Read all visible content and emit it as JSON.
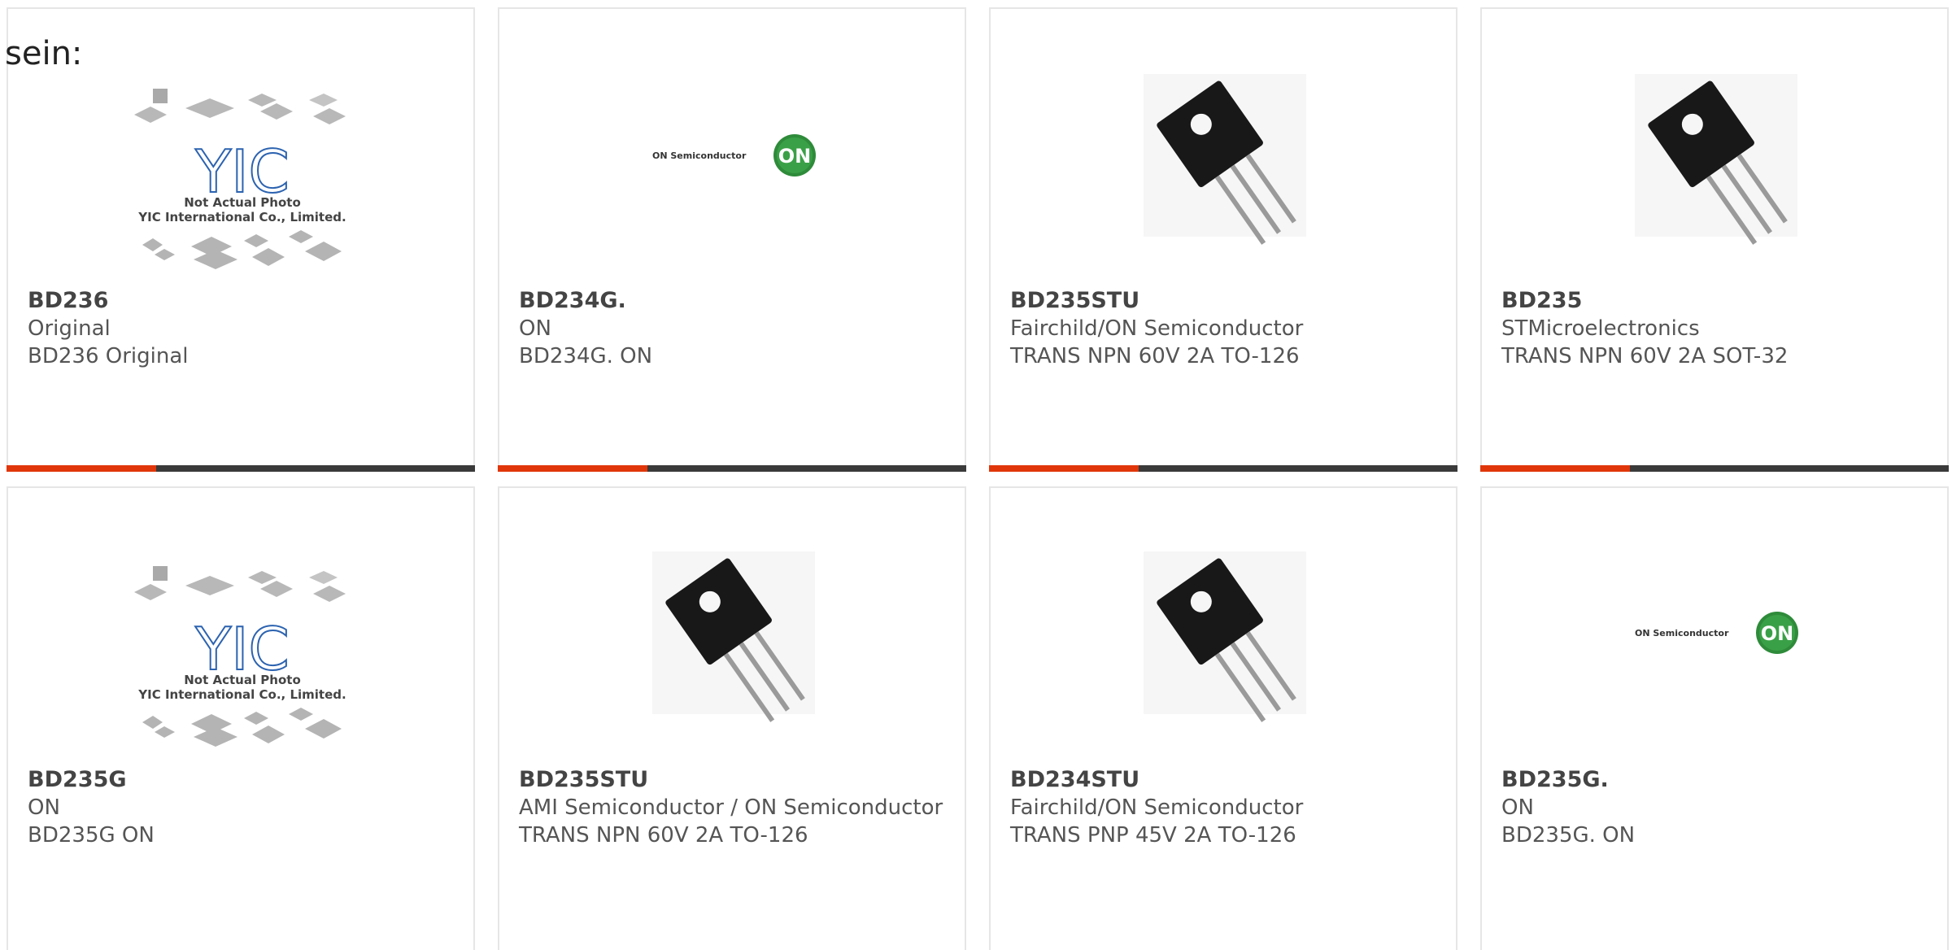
{
  "header_label": "sein:",
  "placeholder_photo": {
    "line1": "Not Actual Photo",
    "line2": "YIC International Co., Limited.",
    "brand": "YIC"
  },
  "on_logo": {
    "wordmark": "ON Semiconductor",
    "badge": "ON"
  },
  "accent_color": "#e0360a",
  "bar_color": "#3a3a3a",
  "products": [
    {
      "part": "BD236",
      "maker": "Original",
      "desc": "BD236 Original",
      "image": "yic-placeholder"
    },
    {
      "part": "BD234G.",
      "maker": "ON",
      "desc": "BD234G. ON",
      "image": "on-semiconductor-logo"
    },
    {
      "part": "BD235STU",
      "maker": "Fairchild/ON Semiconductor",
      "desc": "TRANS NPN 60V 2A TO-126",
      "image": "to126-transistor"
    },
    {
      "part": "BD235",
      "maker": "STMicroelectronics",
      "desc": "TRANS NPN 60V 2A SOT-32",
      "image": "to126-transistor"
    },
    {
      "part": "BD235G",
      "maker": "ON",
      "desc": "BD235G ON",
      "image": "yic-placeholder"
    },
    {
      "part": "BD235STU",
      "maker": "AMI Semiconductor / ON Semiconductor",
      "desc": "TRANS NPN 60V 2A TO-126",
      "image": "to126-transistor"
    },
    {
      "part": "BD234STU",
      "maker": "Fairchild/ON Semiconductor",
      "desc": "TRANS PNP 45V 2A TO-126",
      "image": "to126-transistor"
    },
    {
      "part": "BD235G.",
      "maker": "ON",
      "desc": "BD235G. ON",
      "image": "on-semiconductor-logo"
    }
  ]
}
